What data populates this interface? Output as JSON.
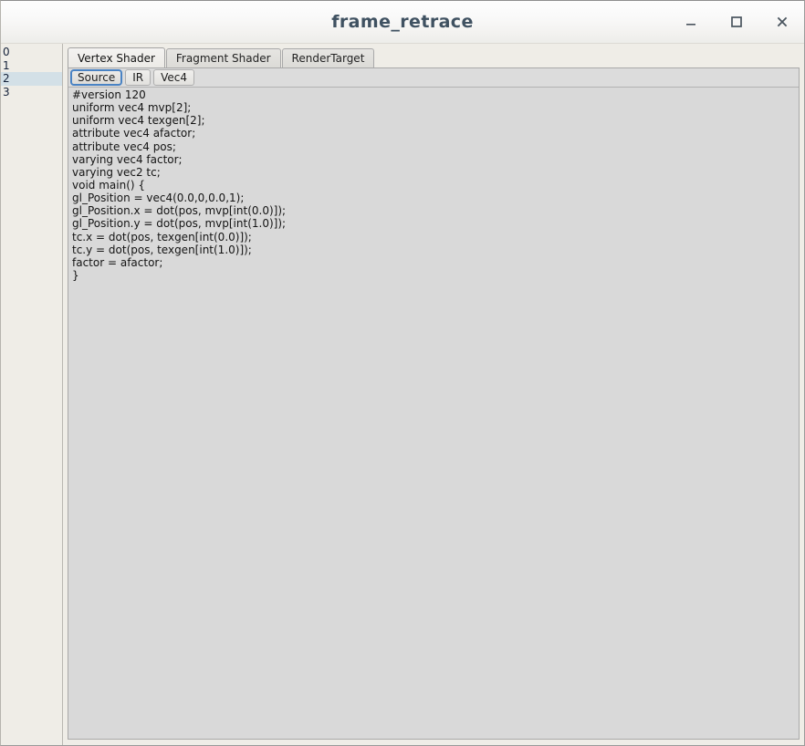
{
  "window": {
    "title": "frame_retrace",
    "controls": [
      {
        "name": "minimize-button",
        "label": "–",
        "icon": "minimize-icon"
      },
      {
        "name": "maximize-button",
        "label": "□",
        "icon": "maximize-icon"
      },
      {
        "name": "close-button",
        "label": "✕",
        "icon": "close-icon"
      }
    ]
  },
  "sidebar": {
    "rows": [
      {
        "label": "0",
        "selected": false
      },
      {
        "label": "1",
        "selected": false
      },
      {
        "label": "2",
        "selected": true
      },
      {
        "label": "3",
        "selected": false
      }
    ],
    "selected_index": 2
  },
  "main": {
    "outer_tabs": [
      {
        "label": "Vertex Shader",
        "active": true
      },
      {
        "label": "Fragment Shader",
        "active": false
      },
      {
        "label": "RenderTarget",
        "active": false
      }
    ],
    "inner_tabs": [
      {
        "label": "Source",
        "active": true
      },
      {
        "label": "IR",
        "active": false
      },
      {
        "label": "Vec4",
        "active": false
      }
    ],
    "source_lines": [
      "#version 120",
      "uniform vec4 mvp[2];",
      "uniform vec4 texgen[2];",
      "attribute vec4 afactor;",
      "attribute vec4 pos;",
      "varying vec4 factor;",
      "varying vec2 tc;",
      "void main() {",
      "gl_Position = vec4(0.0,0,0.0,1);",
      "gl_Position.x = dot(pos, mvp[int(0.0)]);",
      "gl_Position.y = dot(pos, mvp[int(1.0)]);",
      "tc.x = dot(pos, texgen[int(0.0)]);",
      "tc.y = dot(pos, texgen[int(1.0)]);",
      "factor = afactor;",
      "}"
    ]
  },
  "colors": {
    "titlebar_text": "#3f5161",
    "window_chrome": "#EFEDE7",
    "content_bg": "#D9D9D9",
    "selection_highlight": "#d3e0e7",
    "focus_outline": "#4a83c4"
  }
}
